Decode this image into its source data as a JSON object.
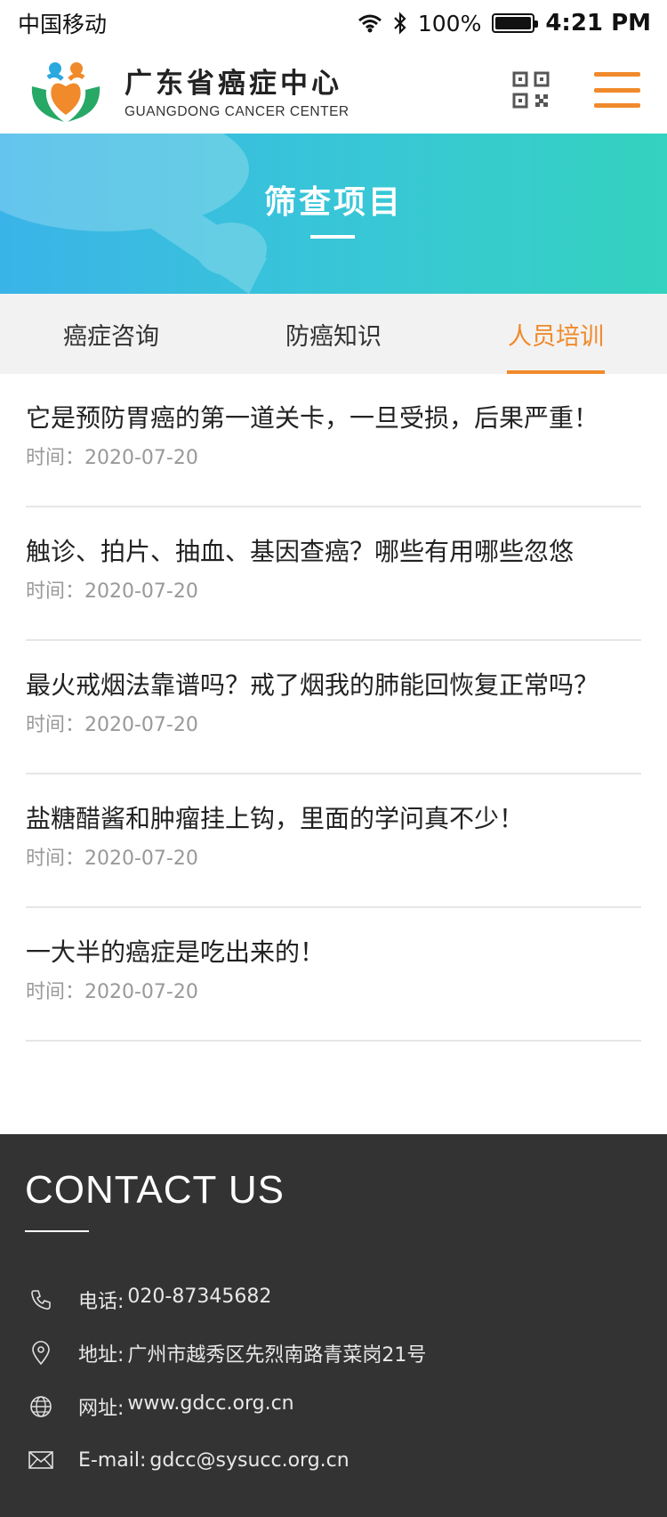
{
  "status_bar": {
    "carrier": "中国移动",
    "battery": "100%",
    "battery_level": 1.0,
    "time": "4:21 PM"
  },
  "header": {
    "brand_cn": "广东省癌症中心",
    "brand_en": "GUANGDONG CANCER CENTER",
    "accent_color": "#f08a2a"
  },
  "banner": {
    "title": "筛查项目"
  },
  "tabs": [
    {
      "label": "癌症咨询",
      "active": false
    },
    {
      "label": "防癌知识",
      "active": false
    },
    {
      "label": "人员培训",
      "active": true
    }
  ],
  "articles": [
    {
      "title": "它是预防胃癌的第一道关卡，一旦受损，后果严重！",
      "date": "时间：2020-07-20"
    },
    {
      "title": "触诊、拍片、抽血、基因查癌？哪些有用哪些忽悠",
      "date": "时间：2020-07-20"
    },
    {
      "title": "最火戒烟法靠谱吗？戒了烟我的肺能回恢复正常吗？",
      "date": "时间：2020-07-20"
    },
    {
      "title": "盐糖醋酱和肿瘤挂上钩，里面的学问真不少！",
      "date": "时间：2020-07-20"
    },
    {
      "title": "一大半的癌症是吃出来的！",
      "date": "时间：2020-07-20"
    }
  ],
  "footer": {
    "title": "CONTACT US",
    "contacts": [
      {
        "icon": "phone-icon",
        "label": "电话:",
        "value": "020-87345682"
      },
      {
        "icon": "location-icon",
        "label": "地址:",
        "value": "广州市越秀区先烈南路青菜岗21号"
      },
      {
        "icon": "globe-icon",
        "label": "网址:",
        "value": "www.gdcc.org.cn"
      },
      {
        "icon": "mail-icon",
        "label": "E-mail:",
        "value": "gdcc@sysucc.org.cn"
      }
    ]
  }
}
